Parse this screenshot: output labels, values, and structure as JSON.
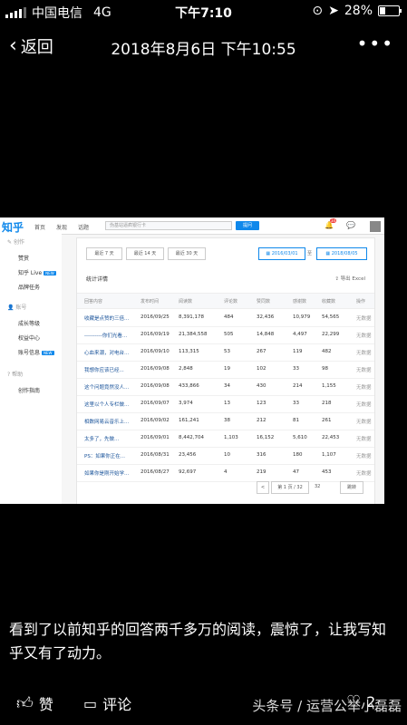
{
  "status": {
    "carrier": "中国电信",
    "network": "4G",
    "time": "下午7:10",
    "battery": "28%",
    "battery_level": 0.28
  },
  "nav": {
    "back_label": "返回",
    "title": "2018年8月6日 下午10:55",
    "more": "•••"
  },
  "zhihu": {
    "logo": "知乎",
    "nav_items": [
      "首页",
      "发现",
      "话题"
    ],
    "search_placeholder": "伪基站逼疯银行卡",
    "ask_label": "提问",
    "notify_count": "34",
    "sidebar": {
      "group1_title": "创作",
      "items1": [
        "赞赏",
        "知乎 Live",
        "品牌任务"
      ],
      "live_badge": "NEW",
      "group2_title": "账号",
      "items2": [
        "成长等级",
        "权益中心",
        "账号信息"
      ],
      "info_badge": "NEW",
      "group3_title": "帮助",
      "items3": [
        "创作指南"
      ]
    },
    "ranges": [
      "最近 7 天",
      "最近 14 天",
      "最近 30 天"
    ],
    "date_from": "2016/03/01",
    "date_sep": "至",
    "date_to": "2018/08/05",
    "table_title": "统计详情",
    "export_label": "导出 Excel",
    "headers": [
      "回答内容",
      "发布时间",
      "阅读数",
      "评论数",
      "赞同数",
      "感谢数",
      "收藏数",
      "操作"
    ],
    "rows": [
      [
        "收藏是点赞的三倍...",
        "2016/09/25",
        "8,391,178",
        "484",
        "32,436",
        "10,979",
        "54,565",
        "无数据"
      ],
      [
        "----------你们光看...",
        "2016/09/19",
        "21,384,558",
        "505",
        "14,848",
        "4,497",
        "22,299",
        "无数据"
      ],
      [
        "心血来潮，对电台...",
        "2016/09/10",
        "113,315",
        "53",
        "267",
        "119",
        "482",
        "无数据"
      ],
      [
        "我想你应该已经...",
        "2016/09/08",
        "2,848",
        "19",
        "102",
        "33",
        "98",
        "无数据"
      ],
      [
        "这个问题竟然没人...",
        "2016/09/08",
        "433,866",
        "34",
        "430",
        "214",
        "1,155",
        "无数据"
      ],
      [
        "这里以个人专栏做...",
        "2016/09/07",
        "3,974",
        "13",
        "123",
        "33",
        "218",
        "无数据"
      ],
      [
        "相数网易云音乐上...",
        "2016/09/02",
        "161,241",
        "38",
        "212",
        "81",
        "261",
        "无数据"
      ],
      [
        "太多了，先做...",
        "2016/09/01",
        "8,442,704",
        "1,103",
        "16,152",
        "5,610",
        "22,453",
        "无数据"
      ],
      [
        "PS：如果你正在...",
        "2016/08/31",
        "23,456",
        "10",
        "316",
        "180",
        "1,107",
        "无数据"
      ],
      [
        "如果你是刚开始学...",
        "2016/08/27",
        "92,697",
        "4",
        "219",
        "47",
        "453",
        "无数据"
      ]
    ],
    "pager": {
      "prev": "<",
      "current": "第 1 页 / 32",
      "next": ">",
      "page_count": "32",
      "jump": "跳转"
    }
  },
  "caption": "看到了以前知乎的回答两千多万的阅读，震惊了，让我写知乎又有了动力。",
  "bottom": {
    "like": "赞",
    "comment": "评论",
    "share_count": "2",
    "watermark": "头条号 / 运营公举小磊磊"
  }
}
